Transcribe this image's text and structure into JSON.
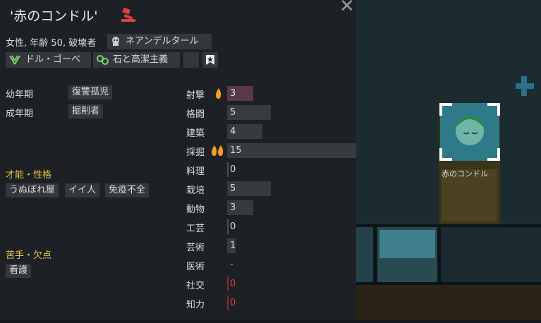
{
  "header": {
    "name": "'赤のコンドル'",
    "close_label": "✕"
  },
  "bio": {
    "summary": "女性, 年齢 50, 破壊者",
    "xenotype": "ネアンデルタール",
    "ideoligion": "ドル・ゴーベ",
    "faction": "石と高潔主義"
  },
  "backstory": {
    "childhood_label": "幼年期",
    "childhood": "復讐孤児",
    "adulthood_label": "成年期",
    "adulthood": "掘削者"
  },
  "traits": {
    "heading": "才能・性格",
    "items": [
      "うぬぼれ屋",
      "イイ人",
      "免疫不全"
    ]
  },
  "incapable": {
    "heading": "苦手・欠点",
    "items": [
      "看護"
    ]
  },
  "skills": [
    {
      "name": "射撃",
      "value": "3",
      "level": 3,
      "passion": "minor",
      "disabled": false,
      "red": true
    },
    {
      "name": "格闘",
      "value": "5",
      "level": 5,
      "passion": "none",
      "disabled": false
    },
    {
      "name": "建築",
      "value": "4",
      "level": 4,
      "passion": "none",
      "disabled": false
    },
    {
      "name": "採掘",
      "value": "15",
      "level": 15,
      "passion": "major",
      "disabled": false
    },
    {
      "name": "料理",
      "value": "0",
      "level": 0,
      "passion": "none",
      "disabled": false
    },
    {
      "name": "栽培",
      "value": "5",
      "level": 5,
      "passion": "none",
      "disabled": false
    },
    {
      "name": "動物",
      "value": "3",
      "level": 3,
      "passion": "none",
      "disabled": false
    },
    {
      "name": "工芸",
      "value": "0",
      "level": 0,
      "passion": "none",
      "disabled": false
    },
    {
      "name": "芸術",
      "value": "1",
      "level": 1,
      "passion": "none",
      "disabled": false
    },
    {
      "name": "医術",
      "value": "-",
      "level": 0,
      "passion": "none",
      "disabled": true
    },
    {
      "name": "社交",
      "value": "0",
      "level": 0,
      "passion": "none",
      "disabled": false,
      "red": true
    },
    {
      "name": "知力",
      "value": "0",
      "level": 0,
      "passion": "none",
      "disabled": false,
      "red": true
    }
  ],
  "map": {
    "pawn_label": "赤のコンドル"
  },
  "colors": {
    "accent_yellow": "#e6c84a",
    "red_value": "#d64040",
    "passion_orange": "#f2a020"
  }
}
